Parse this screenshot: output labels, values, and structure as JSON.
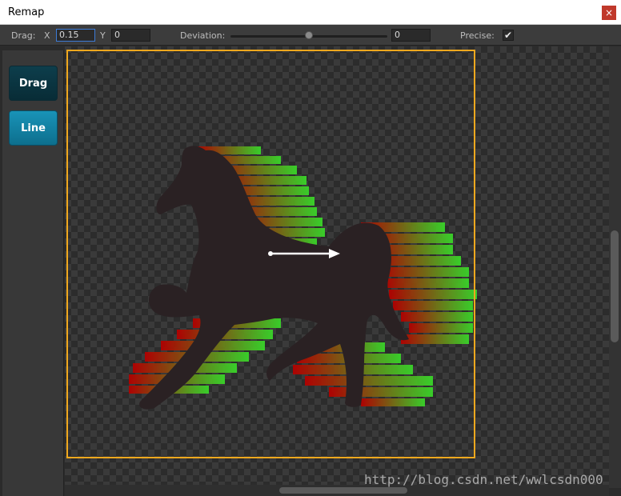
{
  "window": {
    "title": "Remap",
    "close_glyph": "×"
  },
  "toolbar": {
    "drag_label": "Drag:",
    "x_label": "X",
    "x_value": "0.15",
    "y_label": "Y",
    "y_value": "0",
    "deviation_label": "Deviation:",
    "deviation_value": "0",
    "deviation_level": 0.5,
    "precise_label": "Precise:",
    "precise_checked": true,
    "check_glyph": "✔"
  },
  "sidebar": {
    "buttons": [
      {
        "label": "Drag"
      },
      {
        "label": "Line"
      }
    ]
  },
  "canvas": {
    "frame_color": "#f0a81e",
    "silhouette_color": "#2a2123",
    "gradient_colors": [
      "#b40000",
      "#39d62a"
    ],
    "arrow_color": "#ffffff"
  },
  "watermark": "http://blog.csdn.net/wwlcsdn000"
}
